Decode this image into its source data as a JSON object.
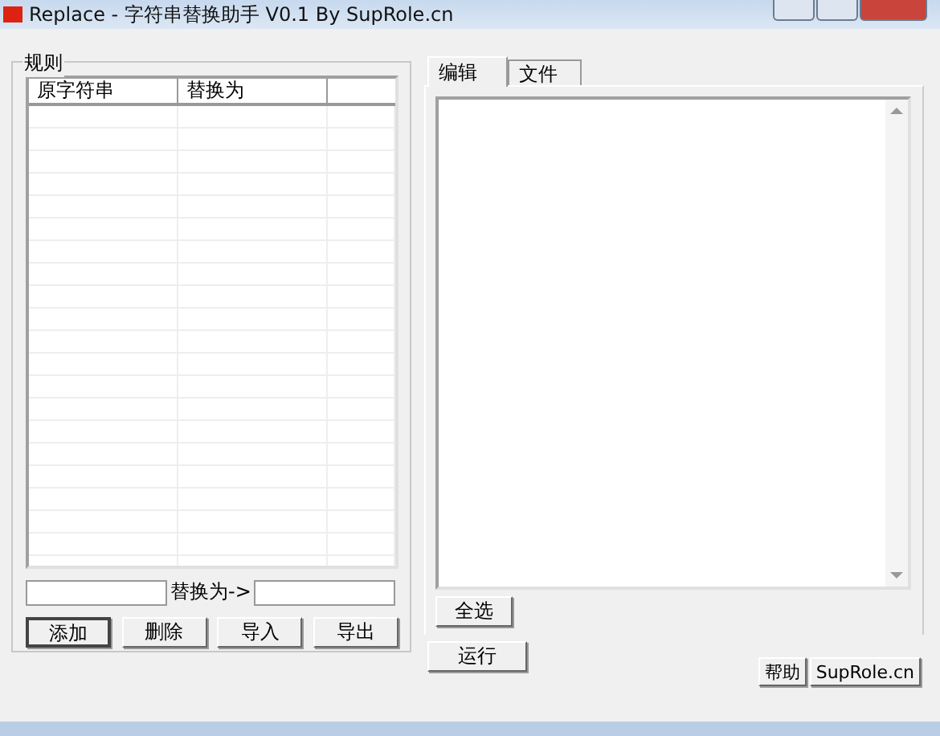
{
  "window": {
    "title": "Replace - 字符串替换助手 V0.1    By SupRole.cn"
  },
  "rules": {
    "title": "规则",
    "columns": [
      "原字符串",
      "替换为"
    ],
    "replace_label": "替换为->",
    "buttons": [
      "添加",
      "删除",
      "导入",
      "导出"
    ]
  },
  "tabs": [
    {
      "label": "编辑",
      "selected": true
    },
    {
      "label": "文件",
      "selected": false
    }
  ],
  "select_all": "全选",
  "run": "运行",
  "footer_buttons": [
    "帮助",
    "SupRole.cn"
  ]
}
